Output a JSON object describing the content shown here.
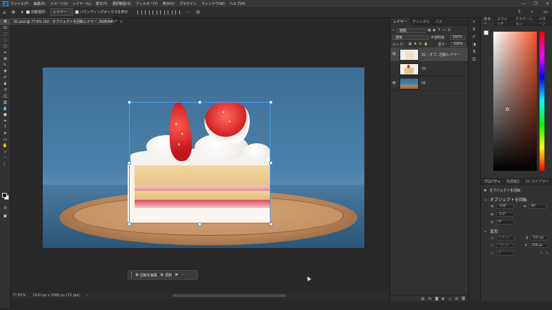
{
  "app": {
    "logo": "Ps"
  },
  "menu": [
    "ファイル(F)",
    "編集(E)",
    "イメージ(I)",
    "レイヤー(L)",
    "書式(Y)",
    "選択範囲(S)",
    "フィルター(T)",
    "表示(V)",
    "プラグイン",
    "ウィンドウ(W)",
    "ヘルプ(H)"
  ],
  "options": {
    "auto_select_label": "自動選択：",
    "auto_select_value": "レイヤー",
    "show_transform_label": "バウンディングボックスを表示"
  },
  "document": {
    "tab_title": "01.psd @ 77.6% (02 - オブジェクトを回転レイヤー, RGB/8#) *",
    "zoom": "77.65%",
    "size": "1920 px x 1080 px (72 ppi)"
  },
  "contextbar": {
    "edit_label": "回転を編集",
    "adjust_label": "調和"
  },
  "layers_panel": {
    "tabs": [
      "レイヤー",
      "チャンネル",
      "パス"
    ],
    "kind_label": "種類",
    "blend_mode": "通常",
    "opacity_label": "不透明度：",
    "opacity_value": "100%",
    "lock_label": "ロック：",
    "fill_label": "塗り：",
    "fill_value": "100%",
    "layers": [
      {
        "name": "02 - オブ...回転レイヤー",
        "visible": true,
        "active": true
      },
      {
        "name": "02",
        "visible": false,
        "active": false
      },
      {
        "name": "01",
        "visible": true,
        "active": false
      }
    ]
  },
  "color_panel": {
    "tabs": [
      "カラー",
      "スウォッチ",
      "グラデーション",
      "パターン"
    ]
  },
  "properties_panel": {
    "tabs": [
      "プロパティ",
      "色調補正",
      "CC ライブラリ"
    ],
    "layer_type": "オブジェクトを回転",
    "section_rotate": "オブジェクトを回転",
    "rotate_h": "-104°",
    "rotate_v": "-5.5°",
    "rotate_z": "0°",
    "rotate_fov": "30°",
    "section_transform": "変形",
    "w_label": "W",
    "w_value": "478 px",
    "h_label": "H",
    "h_value": "756 px",
    "x_label": "X",
    "x_value": "537 px",
    "y_label": "Y",
    "y_value": "208 px",
    "angle": "0°"
  },
  "colors": {
    "accent": "#31a8ff",
    "selection": "#4a9bff"
  }
}
